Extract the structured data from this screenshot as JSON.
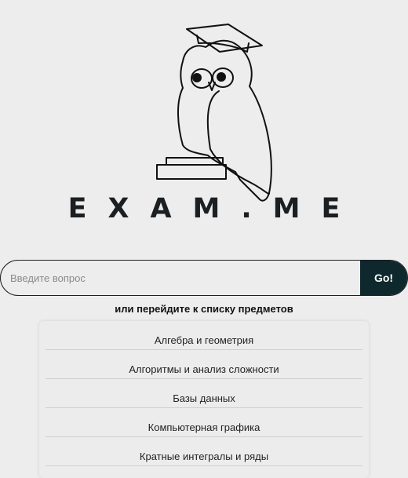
{
  "brand": {
    "name": "EXAM.ME",
    "logo_icon": "owl-graduate-icon"
  },
  "search": {
    "placeholder": "Введите вопрос",
    "value": "",
    "button_label": "Go!"
  },
  "subjects_prompt": "или перейдите к списку предметов",
  "subjects": [
    "Алгебра и геометрия",
    "Алгоритмы и анализ сложности",
    "Базы данных",
    "Компьютерная графика",
    "Кратные интегралы и ряды"
  ],
  "colors": {
    "background": "#ededed",
    "button": "#0e282d",
    "text": "#1b1f22"
  }
}
